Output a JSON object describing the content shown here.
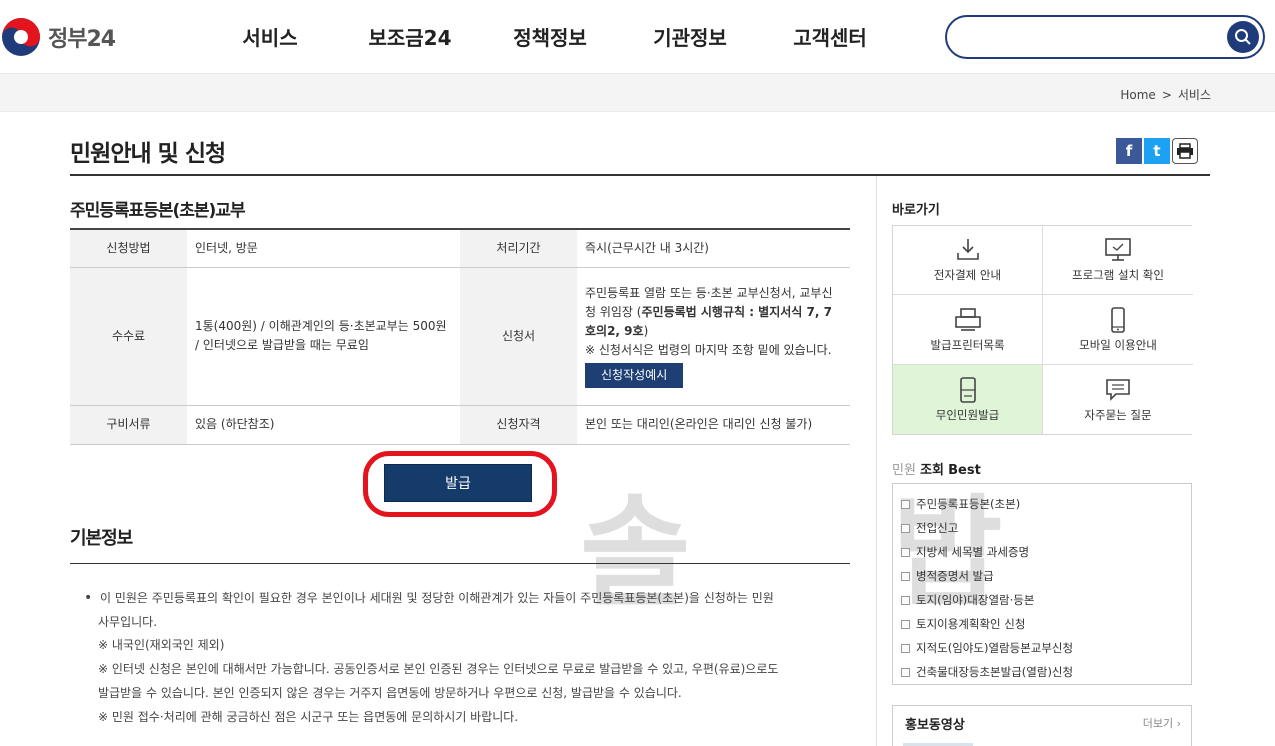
{
  "header": {
    "logo_text": "정부24",
    "nav": [
      "서비스",
      "보조금24",
      "정책정보",
      "기관정보",
      "고객센터"
    ],
    "search": {
      "value": "",
      "placeholder": ""
    }
  },
  "breadcrumb": {
    "home": "Home",
    "sep": ">",
    "current": "서비스"
  },
  "page": {
    "title": "민원안내 및 신청",
    "share": {
      "facebook": "f",
      "twitter": "t",
      "print": "⎙"
    }
  },
  "service": {
    "title": "주민등록표등본(초본)교부",
    "table": {
      "method_label": "신청방법",
      "method_value": "인터넷, 방문",
      "period_label": "처리기간",
      "period_value": "즉시(근무시간 내 3시간)",
      "fee_label": "수수료",
      "fee_value": "1통(400원) / 이해관계인의 등·초본교부는 500원 / 인터넷으로 발급받을 때는 무료임",
      "form_label": "신청서",
      "form_value_1": "주민등록표 열람 또는 등·초본 교부신청서, 교부신청 위임장 (",
      "form_value_bold": "주민등록법 시행규칙 : 별지서식 7, 7호의2, 9호",
      "form_value_2": ")",
      "form_value_note": "※ 신청서식은 법령의 마지막 조항 밑에 있습니다.",
      "form_example_button": "신청작성예시",
      "docs_label": "구비서류",
      "docs_value": "있음 (하단참조)",
      "qual_label": "신청자격",
      "qual_value": "본인 또는 대리인(온라인은 대리인 신청 불가)"
    },
    "issue_button": "발급"
  },
  "watermark": "솔 밥",
  "basic_info": {
    "title": "기본정보",
    "line1_a": "이 민원은 주민등록표의 확인이 필요한 경우 본인이나 세대원 및 정당한 이해관계가 있는 자들이 주민등록표등본(초본)을 신청하는 민원",
    "line1_b": "사무입니다.",
    "line2": "※ 내국인(재외국인 제외)",
    "line3": "※ 인터넷 신청은 본인에 대해서만 가능합니다. 공동인증서로 본인 인증된 경우는 인터넷으로 무료로 발급받을 수 있고, 우편(유료)으로도",
    "line4": "발급받을 수 있습니다. 본인 인증되지 않은 경우는 거주지 읍면동에 방문하거나 우편으로 신청, 발급받을 수 있습니다.",
    "line5": "※ 민원 접수·처리에 관해 궁금하신 점은 시군구 또는 읍면동에 문의하시기 바랍니다."
  },
  "sidebar": {
    "quick_title": "바로가기",
    "quick": [
      {
        "label": "전자결제 안내",
        "icon": "download-icon"
      },
      {
        "label": "프로그램 설치 확인",
        "icon": "monitor-icon"
      },
      {
        "label": "발급프린터목록",
        "icon": "printer-icon"
      },
      {
        "label": "모바일 이용안내",
        "icon": "mobile-icon"
      },
      {
        "label": "무인민원발급",
        "icon": "kiosk-icon"
      },
      {
        "label": "자주묻는 질문",
        "icon": "chat-icon"
      }
    ],
    "best_title_pre": "민원",
    "best_title_main": "조회",
    "best_title_suffix": "Best",
    "best": [
      "주민등록표등본(초본)",
      "전입신고",
      "지방세 세목별 과세증명",
      "병적증명서 발급",
      "토지(임야)대장열람·등본",
      "토지이용계획확인 신청",
      "지적도(임야도)열람등본교부신청",
      "건축물대장등초본발급(열람)신청"
    ],
    "promo_title": "홍보동영상",
    "promo_more": "더보기 ›"
  },
  "colors": {
    "primary_navy": "#143b6a",
    "highlight_red": "#e3141e",
    "active_green": "#e0f5d8",
    "search_border": "#1f3b7a"
  }
}
